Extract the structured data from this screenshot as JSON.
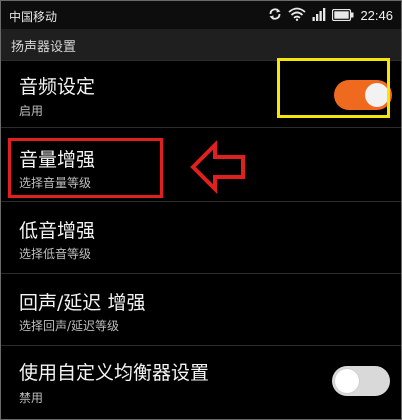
{
  "status_bar": {
    "carrier": "中国移动",
    "time": "22:46",
    "icons": [
      "sync-icon",
      "wifi-icon",
      "signal-icon",
      "battery-icon"
    ]
  },
  "section": {
    "title": "扬声器设置"
  },
  "items": [
    {
      "title": "音频设定",
      "subtitle": "启用",
      "toggle": "on"
    },
    {
      "title": "音量增强",
      "subtitle": "选择音量等级"
    },
    {
      "title": "低音增强",
      "subtitle": "选择低音等级"
    },
    {
      "title": "回声/延迟 增强",
      "subtitle": "选择回声/延迟等级"
    },
    {
      "title": "使用自定义均衡器设置",
      "subtitle": "禁用",
      "toggle": "off"
    }
  ],
  "colors": {
    "toggle_on": "#ef6a1f",
    "annotation_yellow": "#f2e60a",
    "annotation_red": "#e0201e"
  }
}
